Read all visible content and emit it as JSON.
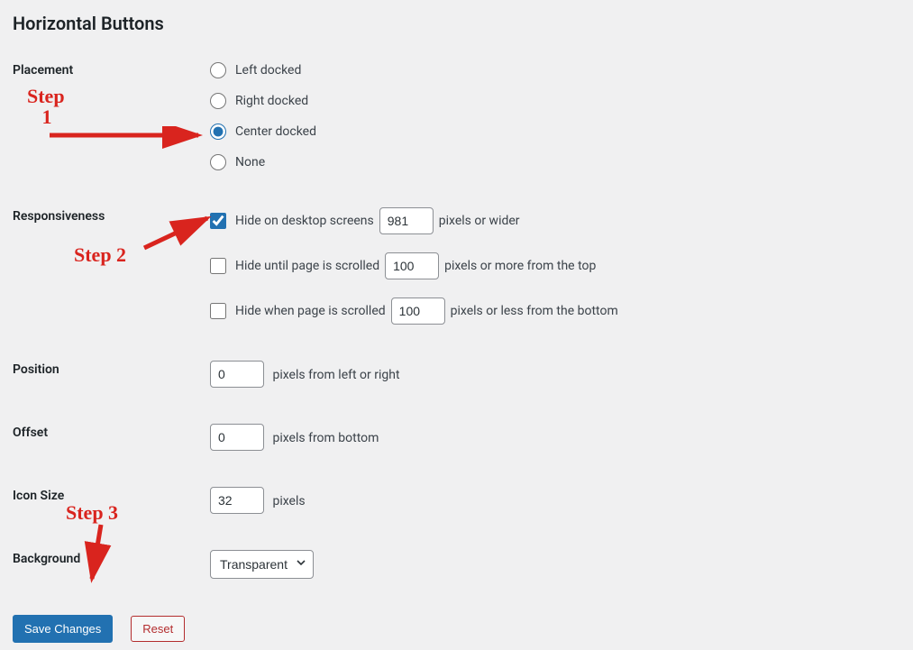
{
  "section_title": "Horizontal Buttons",
  "placement": {
    "label": "Placement",
    "options": {
      "left": "Left docked",
      "right": "Right docked",
      "center": "Center docked",
      "none": "None"
    },
    "selected": "center"
  },
  "responsiveness": {
    "label": "Responsiveness",
    "hide_desktop": {
      "checked": true,
      "text_before": "Hide on desktop screens",
      "value": "981",
      "text_after": "pixels or wider"
    },
    "hide_until_scroll": {
      "checked": false,
      "text_before": "Hide until page is scrolled",
      "value": "100",
      "text_after": "pixels or more from the top"
    },
    "hide_when_scroll_bottom": {
      "checked": false,
      "text_before": "Hide when page is scrolled",
      "value": "100",
      "text_after": "pixels or less from the bottom"
    }
  },
  "position": {
    "label": "Position",
    "value": "0",
    "suffix": "pixels from left or right"
  },
  "offset": {
    "label": "Offset",
    "value": "0",
    "suffix": "pixels from bottom"
  },
  "icon_size": {
    "label": "Icon Size",
    "value": "32",
    "suffix": "pixels"
  },
  "background": {
    "label": "Background",
    "selected": "Transparent"
  },
  "buttons": {
    "save": "Save Changes",
    "reset": "Reset"
  },
  "annotations": {
    "step1": "Step 1",
    "step2": "Step 2",
    "step3": "Step 3"
  }
}
